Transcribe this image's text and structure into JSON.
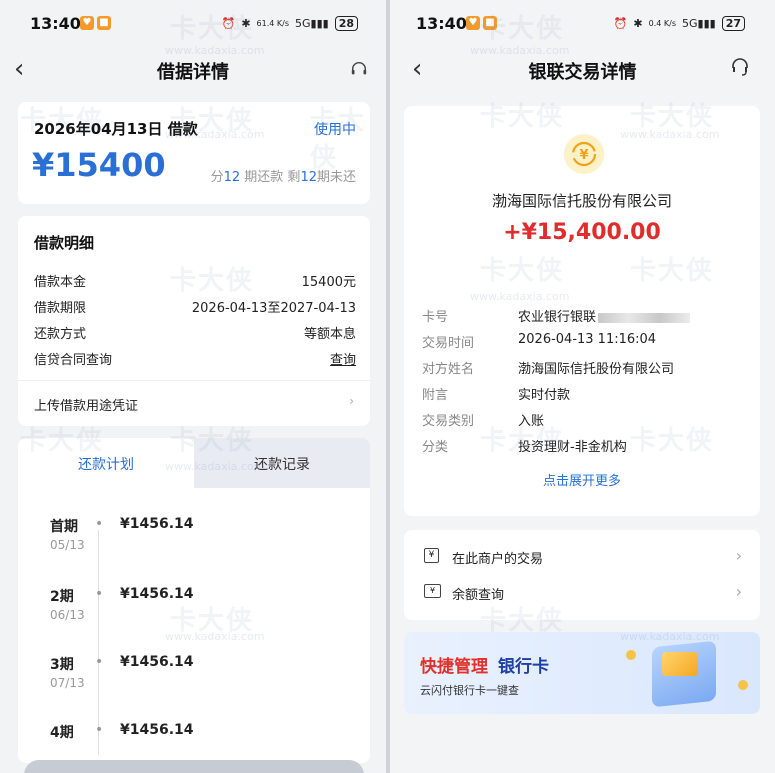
{
  "left": {
    "status": {
      "time": "13:40",
      "battery": "28",
      "net": "61.4 K/s"
    },
    "nav": {
      "title": "借据详情"
    },
    "loan": {
      "date_label": "2026年04月13日 借款",
      "status": "使用中",
      "amount": "¥15400",
      "terms_pre": "分",
      "terms_total": "12",
      "terms_mid": " 期还款 剩",
      "terms_left": "12",
      "terms_post": "期未还"
    },
    "detail": {
      "title": "借款明细",
      "rows": [
        {
          "label": "借款本金",
          "value": "15400元"
        },
        {
          "label": "借款期限",
          "value": "2026-04-13至2027-04-13"
        },
        {
          "label": "还款方式",
          "value": "等额本息"
        },
        {
          "label": "信贷合同查询",
          "value": "查询"
        }
      ],
      "upload_label": "上传借款用途凭证"
    },
    "tabs": [
      {
        "label": "还款计划",
        "active": true
      },
      {
        "label": "还款记录",
        "active": false
      }
    ],
    "schedule": [
      {
        "period": "首期",
        "date": "05/13",
        "amount": "¥1456.14"
      },
      {
        "period": "2期",
        "date": "06/13",
        "amount": "¥1456.14"
      },
      {
        "period": "3期",
        "date": "07/13",
        "amount": "¥1456.14"
      },
      {
        "period": "4期",
        "date": "",
        "amount": "¥1456.14"
      }
    ]
  },
  "right": {
    "status": {
      "time": "13:40",
      "battery": "27",
      "net": "0.4 K/s"
    },
    "nav": {
      "title": "银联交易详情"
    },
    "merchant": "渤海国际信托股份有限公司",
    "amount": "+¥15,400.00",
    "rows": [
      {
        "label": "卡号",
        "value": "农业银行银联"
      },
      {
        "label": "交易时间",
        "value": "2026-04-13 11:16:04"
      },
      {
        "label": "对方姓名",
        "value": "渤海国际信托股份有限公司"
      },
      {
        "label": "附言",
        "value": "实时付款"
      },
      {
        "label": "交易类别",
        "value": "入账"
      },
      {
        "label": "分类",
        "value": "投资理财-非金机构"
      }
    ],
    "expand": "点击展开更多",
    "links": [
      {
        "label": "在此商户的交易"
      },
      {
        "label": "余额查询"
      }
    ],
    "banner": {
      "title_a": "快捷管理",
      "title_b": "银行卡",
      "subtitle": "云闪付银行卡一键查"
    }
  },
  "watermark": {
    "text": "卡大侠",
    "url": "www.kadaxia.com"
  },
  "colors": {
    "blue": "#2a6fd6",
    "red": "#e02c2c",
    "orange": "#f39a2c"
  }
}
